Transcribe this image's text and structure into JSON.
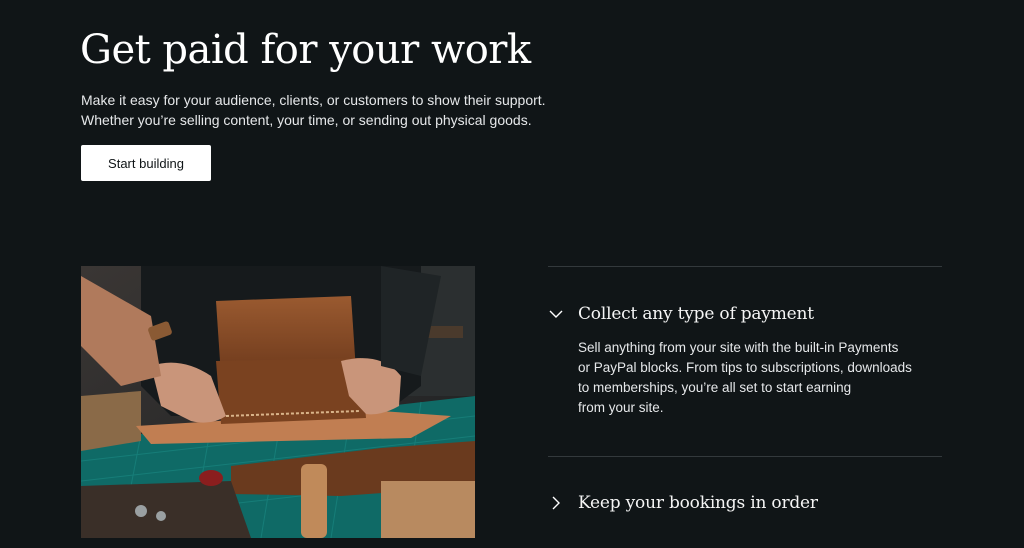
{
  "hero": {
    "title": "Get paid for your work",
    "subtitle_lines": [
      "Make it easy for your audience, clients, or customers to show their support.",
      "Whether you’re selling content, your time, or sending out physical goods."
    ],
    "cta_label": "Start building"
  },
  "image": {
    "subject": "leather-craft-photo"
  },
  "accordion": {
    "items": [
      {
        "title": "Collect any type of payment",
        "expanded": true,
        "icon": "chevron-down-icon",
        "body_lines": [
          "Sell anything from your site with the built-in Payments",
          "or PayPal blocks. From tips to subscriptions, downloads",
          "to memberships, you’re all set to start earning",
          "from your site."
        ]
      },
      {
        "title": "Keep your bookings in order",
        "expanded": false,
        "icon": "chevron-right-icon"
      }
    ]
  },
  "colors": {
    "background": "#101517",
    "text": "#ffffff",
    "button_bg": "#ffffff",
    "button_text": "#101517",
    "divider": "#33393c"
  }
}
